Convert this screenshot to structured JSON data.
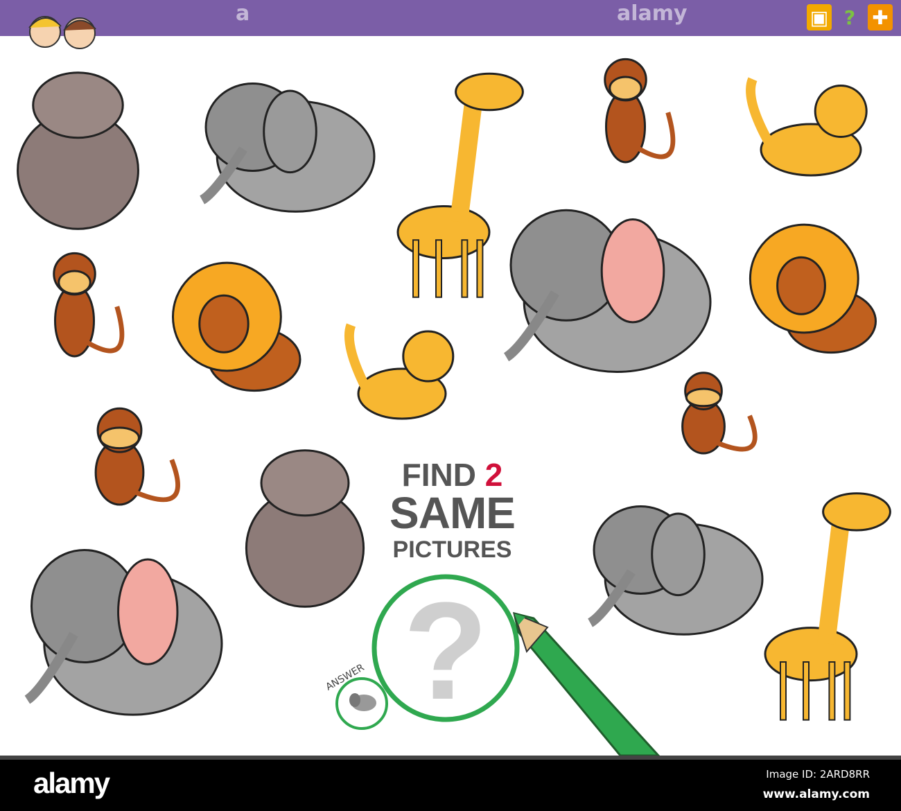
{
  "header": {
    "watermark": "a",
    "watermark2": "alamy",
    "icons": [
      "maze-icon",
      "question-icon",
      "puzzle-icon"
    ],
    "question_mark": "?"
  },
  "puzzle": {
    "title_find": "FIND",
    "title_number": "2",
    "title_same": "SAME",
    "title_pictures": "PICTURES",
    "answer_label": "ANSWER",
    "question_mark": "?"
  },
  "animals": [
    {
      "type": "hippo"
    },
    {
      "type": "elephant-gray"
    },
    {
      "type": "giraffe"
    },
    {
      "type": "monkey"
    },
    {
      "type": "tiger"
    },
    {
      "type": "monkey"
    },
    {
      "type": "lion"
    },
    {
      "type": "tiger"
    },
    {
      "type": "elephant-big"
    },
    {
      "type": "lion"
    },
    {
      "type": "monkey"
    },
    {
      "type": "monkey"
    },
    {
      "type": "hippo"
    },
    {
      "type": "elephant-big"
    },
    {
      "type": "elephant-gray"
    },
    {
      "type": "giraffe"
    }
  ],
  "footer": {
    "logo": "alamy",
    "image_id": "Image ID: 2ARD8RR",
    "url": "www.alamy.com"
  },
  "colors": {
    "bar": "#7b5ea7",
    "green": "#2fa84f",
    "red": "#d0103a"
  }
}
